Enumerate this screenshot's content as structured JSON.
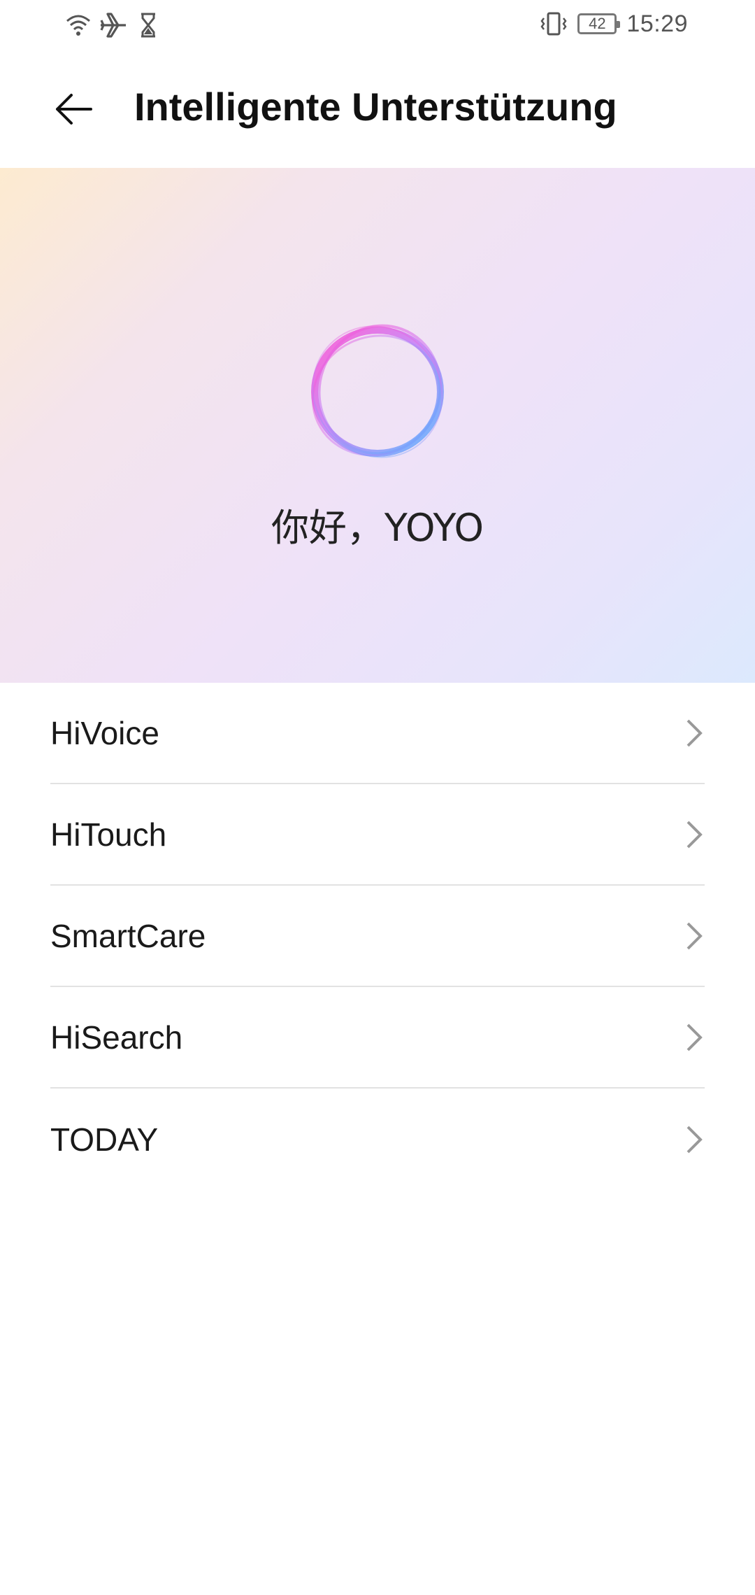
{
  "status_bar": {
    "left_icons": [
      "wifi-icon",
      "airplane-icon",
      "hourglass-icon"
    ],
    "right_icons": [
      "vibrate-icon",
      "battery-icon"
    ],
    "battery_level": "42",
    "time": "15:29"
  },
  "header": {
    "back_icon": "arrow-left-icon",
    "title": "Intelligente Unterstützung"
  },
  "hero": {
    "logo_icon": "assistant-orb-icon",
    "greeting": "你好，YOYO",
    "gradient_colors": [
      "#fdebd0",
      "#efe2f8",
      "#dce9fd"
    ]
  },
  "menu": {
    "items": [
      {
        "label": "HiVoice"
      },
      {
        "label": "HiTouch"
      },
      {
        "label": "SmartCare"
      },
      {
        "label": "HiSearch"
      },
      {
        "label": "TODAY"
      }
    ],
    "chevron_icon": "chevron-right-icon"
  }
}
